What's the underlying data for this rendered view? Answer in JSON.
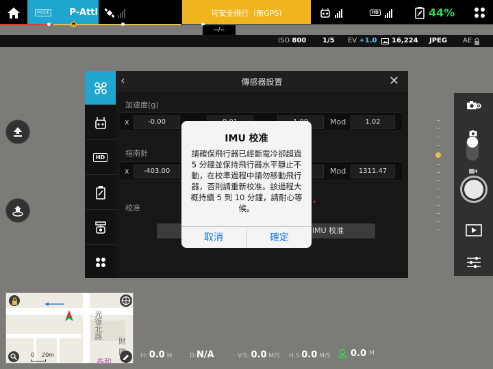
{
  "topbar": {
    "mode_tag": "MODE",
    "mode_name": "P-Atti",
    "status_text": "可安全飛行（無GPS)",
    "hd_badge": "HD",
    "battery_pct": "44%",
    "home_badge": "H",
    "timer": "--/--"
  },
  "camera": {
    "iso_label": "ISO",
    "iso_value": "800",
    "shutter": "1/5",
    "ev_label": "EV",
    "ev_value": "+1.0",
    "remaining": "16,224",
    "format": "JPEG",
    "ae": "AE"
  },
  "panel": {
    "title": "傳感器設置",
    "accel_section": "加速度(g)",
    "accel_x_label": "x",
    "accel_x": "-0.00",
    "accel_y_partial": "0.01",
    "accel_z_partial": "1.00",
    "accel_mod_label": "Mod",
    "accel_mod": "1.02",
    "compass_section": "指南針",
    "compass_x_label": "x",
    "compass_x": "-403.00",
    "compass_mod_label": "Mod",
    "compass_mod": "1311.47",
    "calib_section": "校准",
    "imu_button": "IMU 校准"
  },
  "dialog": {
    "title": "IMU 校准",
    "message": "請確保飛行器已經斷電冷卻超過 5 分鐘並保持飛行器水平靜止不動，在校準過程中請勿移動飛行器，否則請重新校准。該過程大概持續 5 到 10 分鐘，請耐心等候。",
    "cancel": "取消",
    "confirm": "確定"
  },
  "telemetry": {
    "h_label": "H:",
    "h_value": "0.0",
    "h_unit": "M",
    "d_label": "D:",
    "d_value": "N/A",
    "vs_label": "V.S:",
    "vs_value": "0.0",
    "vs_unit": "M/S",
    "hs_label": "H.S:",
    "hs_value": "0.0",
    "hs_unit": "M/S",
    "home_dist": "0.0",
    "home_unit": "M"
  },
  "map": {
    "scale_zero": "0",
    "scale_label": "20m",
    "road_label": "光復北路",
    "place_label": "財團",
    "place_label2": "泰和"
  }
}
